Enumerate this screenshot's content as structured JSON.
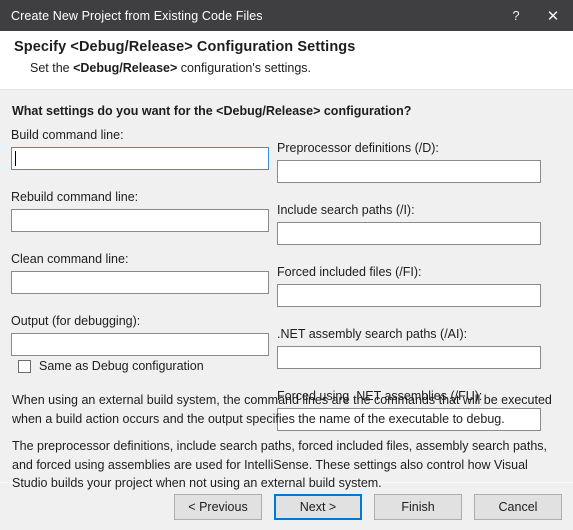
{
  "window": {
    "title": "Create New Project from Existing Code Files",
    "help_icon": "?",
    "close_icon": "✕",
    "titlebar_bg": "#3f3f41",
    "body_bg": "#f0f0f0",
    "accent": "#0078d7",
    "focus_border": "#3a8fd0"
  },
  "header": {
    "title": "Specify  <Debug/Release>  Configuration Settings",
    "subtitle_prefix": "Set the ",
    "subtitle_bold": "<Debug/Release>",
    "subtitle_suffix": " configuration's settings."
  },
  "main": {
    "question": "What settings do you want for the <Debug/Release> configuration?",
    "left_fields": [
      {
        "label": "Build command line:",
        "value": "",
        "placeholder": "",
        "focused": true
      },
      {
        "label": "Rebuild command line:",
        "value": "",
        "placeholder": "",
        "focused": false
      },
      {
        "label": "Clean command line:",
        "value": "",
        "placeholder": "",
        "focused": false
      },
      {
        "label": "Output (for debugging):",
        "value": "",
        "placeholder": "",
        "focused": false
      }
    ],
    "right_fields": [
      {
        "label": "Preprocessor definitions (/D):",
        "value": "",
        "placeholder": "",
        "focused": false
      },
      {
        "label": "Include search paths (/I):",
        "value": "",
        "placeholder": "",
        "focused": false
      },
      {
        "label": "Forced included files (/FI):",
        "value": "",
        "placeholder": "",
        "focused": false
      },
      {
        "label": ".NET assembly search paths (/AI):",
        "value": "",
        "placeholder": "",
        "focused": false
      },
      {
        "label": "Forced using .NET assemblies (/FU):",
        "value": "",
        "placeholder": "",
        "focused": false
      }
    ],
    "checkbox": {
      "label": "Same as Debug configuration",
      "checked": false
    },
    "paragraph_1": "When using an external build system, the command lines are the commands that will be executed when a build action occurs and the output specifies the name of the executable to debug.",
    "paragraph_2": "The preprocessor definitions, include search paths, forced included files, assembly search paths, and forced using assemblies are used for IntelliSense.  These settings also control how Visual Studio builds your project when not using an external build system."
  },
  "footer": {
    "buttons": [
      {
        "label": "< Previous",
        "default": false
      },
      {
        "label": "Next >",
        "default": true
      },
      {
        "label": "Finish",
        "default": false
      },
      {
        "label": "Cancel",
        "default": false
      }
    ]
  }
}
